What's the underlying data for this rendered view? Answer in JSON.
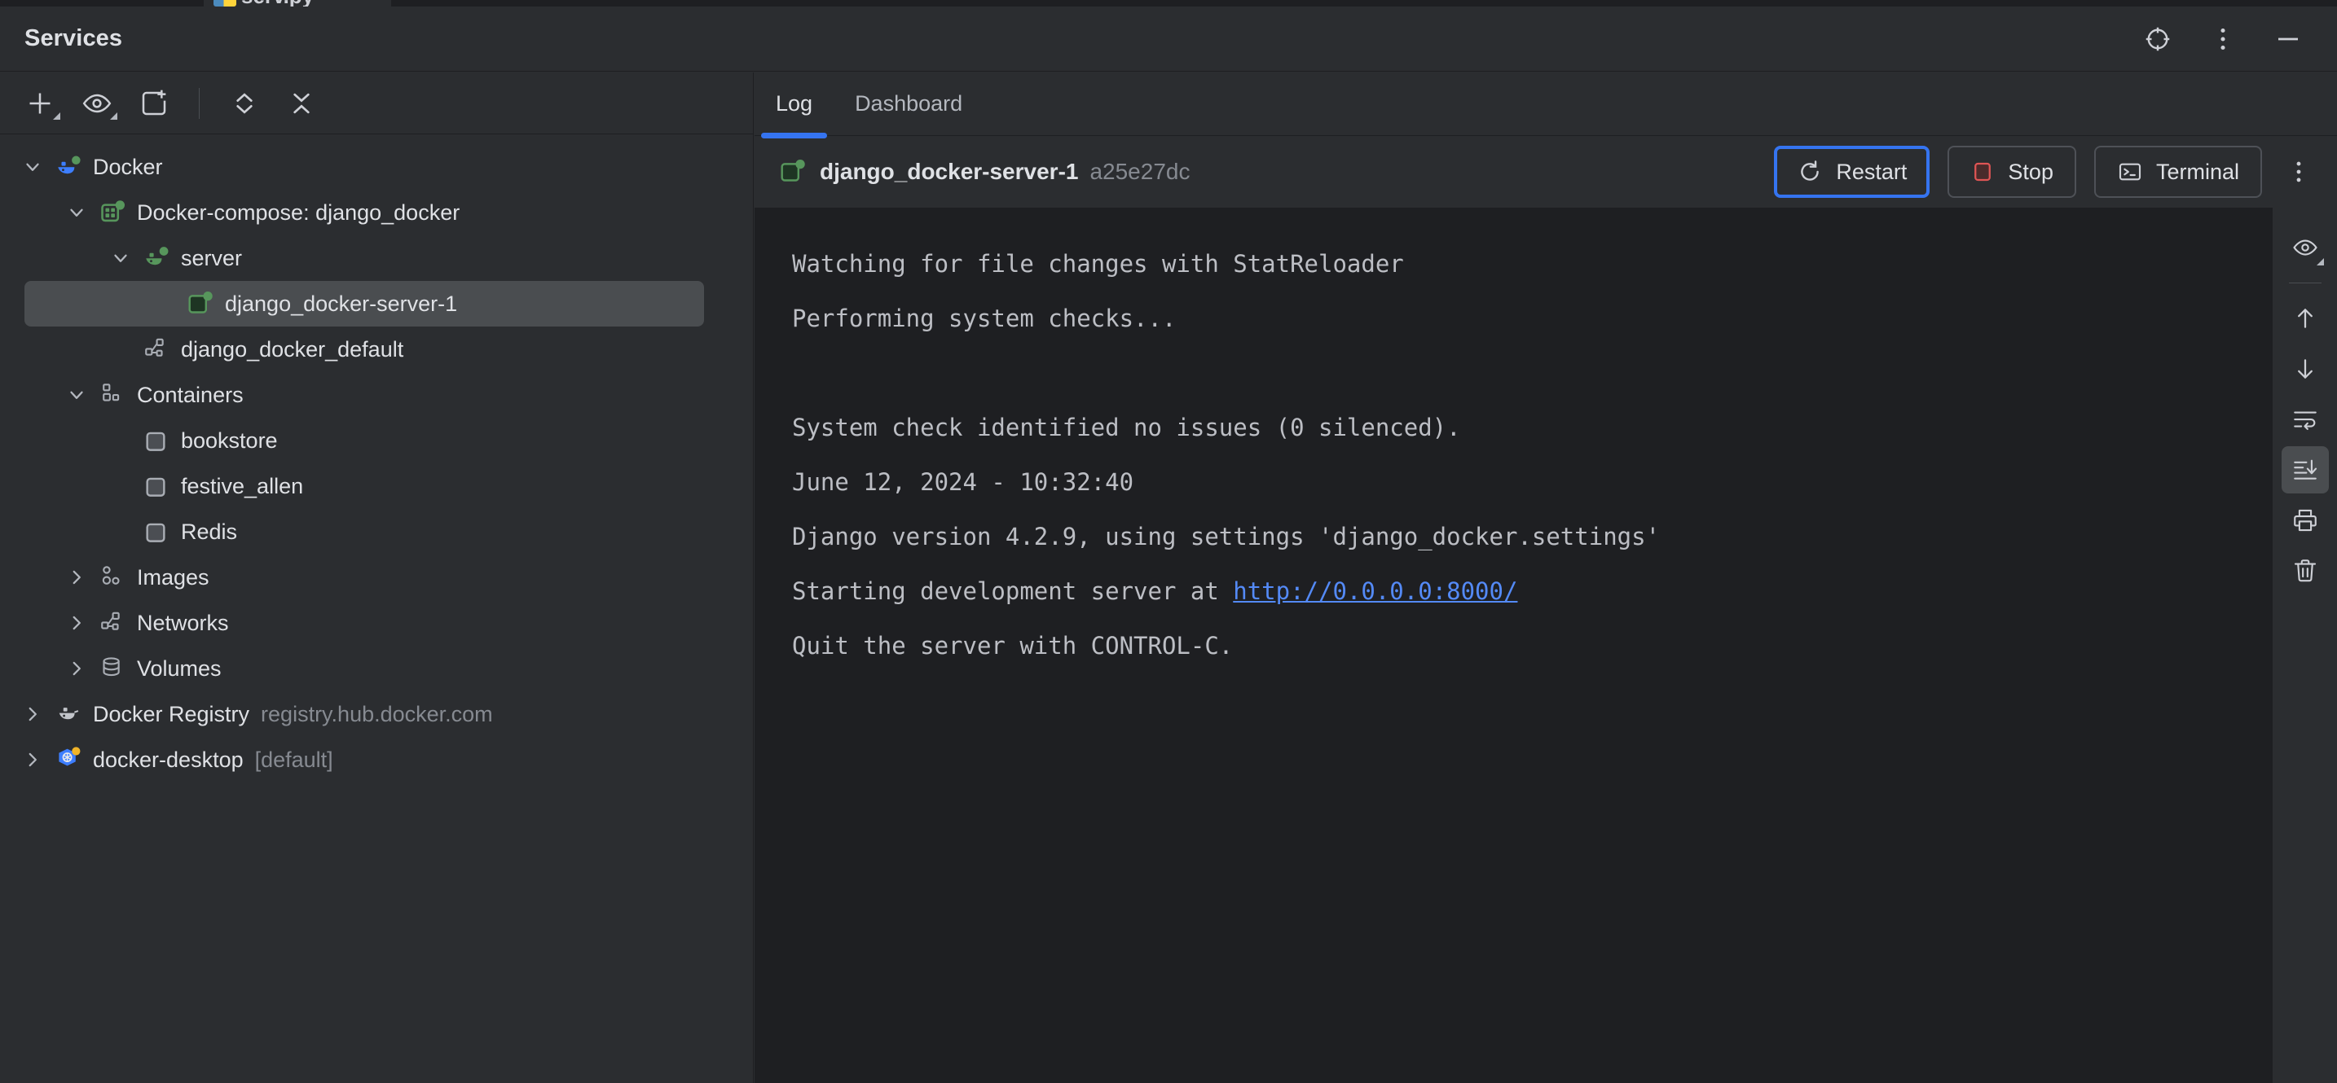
{
  "editor_sliver": {
    "tab_label": "serv.py",
    "icon": "python-file-icon"
  },
  "window": {
    "title": "Services",
    "actions": [
      {
        "name": "locate-target-icon",
        "label": "Select Opened File"
      },
      {
        "name": "more-options-icon",
        "label": "Options"
      },
      {
        "name": "minimize-icon",
        "label": "Hide"
      }
    ]
  },
  "left_toolbar": {
    "buttons": [
      {
        "name": "add-service-button",
        "icon": "plus-icon",
        "label": "Add Service",
        "dropdown": true
      },
      {
        "name": "filter-view-button",
        "icon": "eye-icon",
        "label": "Show/Hide",
        "dropdown": true
      },
      {
        "name": "new-tab-button",
        "icon": "add-tab-icon",
        "label": "New Tab",
        "dropdown": false
      },
      {
        "name": "expand-all-button",
        "icon": "expand-all-icon",
        "label": "Expand All",
        "dropdown": false
      },
      {
        "name": "collapse-all-button",
        "icon": "collapse-all-icon",
        "label": "Collapse All",
        "dropdown": false
      }
    ]
  },
  "tree": {
    "nodes": [
      {
        "name": "tree-node-docker",
        "label": "Docker",
        "sub": "",
        "indent": 0,
        "twisty": "down",
        "icon": "docker-whale-running-icon",
        "selected": false
      },
      {
        "name": "tree-node-docker-compose",
        "label": "Docker-compose: django_docker",
        "sub": "",
        "indent": 1,
        "twisty": "down",
        "icon": "compose-running-icon",
        "selected": false
      },
      {
        "name": "tree-node-server",
        "label": "server",
        "sub": "",
        "indent": 2,
        "twisty": "down",
        "icon": "service-running-icon",
        "selected": false
      },
      {
        "name": "tree-node-django-docker-server-1",
        "label": "django_docker-server-1",
        "sub": "",
        "indent": 3,
        "twisty": "none",
        "icon": "container-running-icon",
        "selected": true
      },
      {
        "name": "tree-node-django-docker-default",
        "label": "django_docker_default",
        "sub": "",
        "indent": 2,
        "twisty": "none",
        "icon": "network-icon",
        "selected": false
      },
      {
        "name": "tree-node-containers",
        "label": "Containers",
        "sub": "",
        "indent": 1,
        "twisty": "down",
        "icon": "containers-icon",
        "selected": false
      },
      {
        "name": "tree-node-bookstore",
        "label": "bookstore",
        "sub": "",
        "indent": 2,
        "twisty": "none",
        "icon": "container-stopped-icon",
        "selected": false
      },
      {
        "name": "tree-node-festive-allen",
        "label": "festive_allen",
        "sub": "",
        "indent": 2,
        "twisty": "none",
        "icon": "container-stopped-icon",
        "selected": false
      },
      {
        "name": "tree-node-redis",
        "label": "Redis",
        "sub": "",
        "indent": 2,
        "twisty": "none",
        "icon": "container-stopped-icon",
        "selected": false
      },
      {
        "name": "tree-node-images",
        "label": "Images",
        "sub": "",
        "indent": 1,
        "twisty": "right",
        "icon": "images-icon",
        "selected": false
      },
      {
        "name": "tree-node-networks",
        "label": "Networks",
        "sub": "",
        "indent": 1,
        "twisty": "right",
        "icon": "network-icon",
        "selected": false
      },
      {
        "name": "tree-node-volumes",
        "label": "Volumes",
        "sub": "",
        "indent": 1,
        "twisty": "right",
        "icon": "volumes-icon",
        "selected": false
      },
      {
        "name": "tree-node-docker-registry",
        "label": "Docker Registry",
        "sub": "registry.hub.docker.com",
        "indent": 0,
        "twisty": "right",
        "icon": "docker-registry-icon",
        "selected": false
      },
      {
        "name": "tree-node-docker-desktop",
        "label": "docker-desktop",
        "sub": "[default]",
        "indent": 0,
        "twisty": "right",
        "icon": "kubernetes-icon",
        "selected": false
      }
    ]
  },
  "main": {
    "tabs": [
      {
        "name": "tab-log",
        "label": "Log",
        "active": true
      },
      {
        "name": "tab-dashboard",
        "label": "Dashboard",
        "active": false
      }
    ],
    "container": {
      "status_icon": "container-running-icon",
      "name": "django_docker-server-1",
      "id": "a25e27dc"
    },
    "actions": [
      {
        "name": "restart-button",
        "label": "Restart",
        "icon": "restart-icon",
        "focused": true
      },
      {
        "name": "stop-button",
        "label": "Stop",
        "icon": "stop-square-icon",
        "focused": false
      },
      {
        "name": "terminal-button",
        "label": "Terminal",
        "icon": "terminal-icon",
        "focused": false
      }
    ],
    "more_actions": {
      "name": "container-more-icon",
      "label": "More Actions"
    }
  },
  "console": {
    "lines": [
      {
        "text": "Watching for file changes with StatReloader",
        "link": null
      },
      {
        "text": "Performing system checks...",
        "link": null
      },
      {
        "text": "",
        "link": null
      },
      {
        "text": "System check identified no issues (0 silenced).",
        "link": null
      },
      {
        "text": "June 12, 2024 - 10:32:40",
        "link": null
      },
      {
        "text": "Django version 4.2.9, using settings 'django_docker.settings'",
        "link": null
      },
      {
        "text": "Starting development server at ",
        "link": "http://0.0.0.0:8000/"
      },
      {
        "text": "Quit the server with CONTROL-C.",
        "link": null
      }
    ]
  },
  "console_toolbar": {
    "buttons": [
      {
        "name": "filter-console-button",
        "icon": "eye-icon",
        "label": "Configure Log Filters",
        "dropdown": true,
        "active": false,
        "separator_after": true
      },
      {
        "name": "previous-occurrence-button",
        "icon": "arrow-up-icon",
        "label": "Up",
        "dropdown": false,
        "active": false,
        "separator_after": false
      },
      {
        "name": "next-occurrence-button",
        "icon": "arrow-down-icon",
        "label": "Down",
        "dropdown": false,
        "active": false,
        "separator_after": false
      },
      {
        "name": "soft-wrap-button",
        "icon": "soft-wrap-icon",
        "label": "Soft-Wrap",
        "dropdown": false,
        "active": false,
        "separator_after": false
      },
      {
        "name": "scroll-to-end-button",
        "icon": "scroll-to-end-icon",
        "label": "Scroll to the End",
        "dropdown": false,
        "active": true,
        "separator_after": false
      },
      {
        "name": "print-button",
        "icon": "print-icon",
        "label": "Print",
        "dropdown": false,
        "active": false,
        "separator_after": false
      },
      {
        "name": "clear-all-button",
        "icon": "trash-icon",
        "label": "Clear All",
        "dropdown": false,
        "active": false,
        "separator_after": false
      }
    ]
  },
  "colors": {
    "accent_blue": "#3574f0",
    "link_blue": "#548af7",
    "running_green": "#57965c",
    "stop_red": "#e05555",
    "panel_bg": "#2b2d30",
    "console_bg": "#1e1f22",
    "selection_bg": "#4a4d50"
  }
}
